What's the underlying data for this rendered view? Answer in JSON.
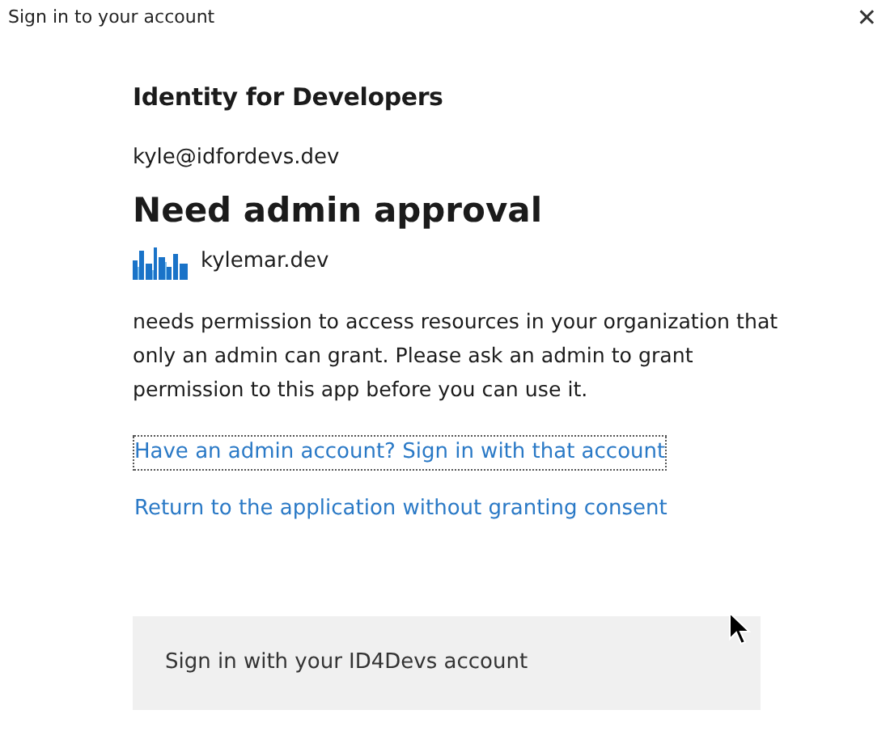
{
  "window": {
    "title": "Sign in to your account",
    "close": "✕"
  },
  "organization": "Identity for Developers",
  "account": "kyle@idfordevs.dev",
  "heading": "Need admin approval",
  "app": {
    "name": "kylemar.dev"
  },
  "message": "needs permission to access resources in your organization that only an admin can grant. Please ask an admin to grant permission to this app before you can use it.",
  "links": [
    {
      "label": "Have an admin account? Sign in with that account",
      "focused": true
    },
    {
      "label": "Return to the application without granting consent",
      "focused": false
    }
  ],
  "footer": {
    "label": "Sign in with your ID4Devs account"
  }
}
